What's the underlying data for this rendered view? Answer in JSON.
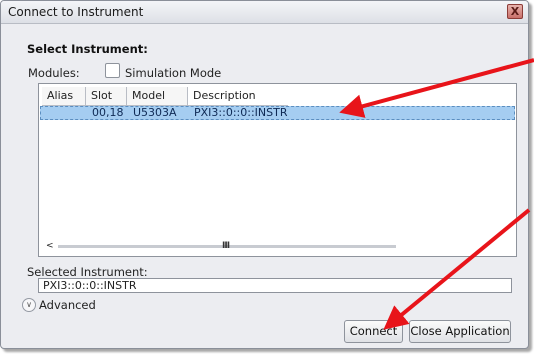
{
  "window": {
    "title": "Connect to Instrument",
    "close_glyph": "X"
  },
  "section_title": "Select Instrument:",
  "modules": {
    "label": "Modules:",
    "simulation_label": "Simulation Mode",
    "simulation_checked": false
  },
  "table": {
    "columns": [
      "Alias",
      "Slot",
      "Model",
      "Description"
    ],
    "rows": [
      {
        "alias": "",
        "slot": "00,18",
        "model": "U5303A",
        "description": "PXI3::0::0::INSTR",
        "selected": true
      }
    ]
  },
  "scrollbar": {
    "left_arrow": "<",
    "grip": "III"
  },
  "selected_instrument": {
    "label": "Selected Instrument:",
    "value": "PXI3::0::0::INSTR"
  },
  "advanced": {
    "label": "Advanced"
  },
  "buttons": {
    "connect": "Connect",
    "close_application": "Close Application"
  },
  "annotation": {
    "arrow_color": "#e8141a"
  }
}
